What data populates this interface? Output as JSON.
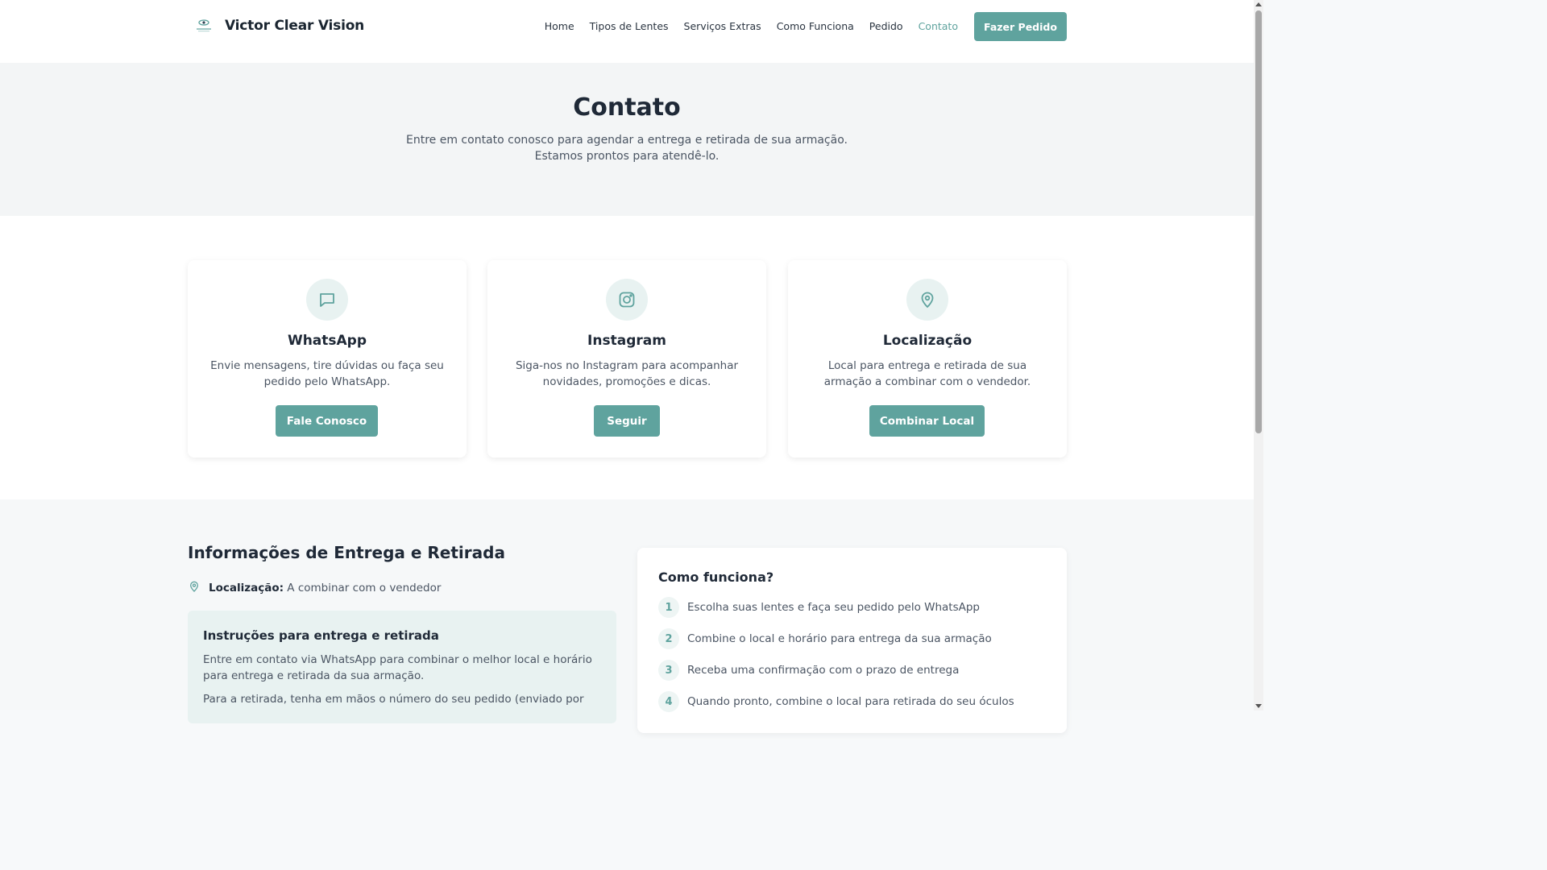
{
  "header": {
    "brand_name": "Victor Clear Vision",
    "nav": [
      "Home",
      "Tipos de Lentes",
      "Serviços Extras",
      "Como Funciona",
      "Pedido",
      "Contato"
    ],
    "active_nav": "Contato",
    "cta_label": "Fazer Pedido"
  },
  "hero": {
    "title": "Contato",
    "subtitle_line1": "Entre em contato conosco para agendar a entrega e retirada de sua armação.",
    "subtitle_line2": "Estamos prontos para atendê-lo."
  },
  "cards": [
    {
      "icon": "chat-bubble-icon",
      "title": "WhatsApp",
      "desc_line1": "Envie mensagens, tire dúvidas ou faça seu",
      "desc_line2": "pedido pelo WhatsApp.",
      "button": "Fale Conosco"
    },
    {
      "icon": "instagram-icon",
      "title": "Instagram",
      "desc_line1": "Siga-nos no Instagram para acompanhar",
      "desc_line2": "novidades, promoções e dicas.",
      "button": "Seguir"
    },
    {
      "icon": "map-pin-icon",
      "title": "Localização",
      "desc_line1": "Local para entrega e retirada de sua",
      "desc_line2": "armação a combinar com o vendedor.",
      "button": "Combinar Local"
    }
  ],
  "info": {
    "title": "Informações de Entrega e Retirada",
    "location_label": "Localização:",
    "location_value": "A combinar com o vendedor",
    "instructions_title": "Instruções para entrega e retirada",
    "instructions_p1": "Entre em contato via WhatsApp para combinar o melhor local e horário para entrega e retirada da sua armação.",
    "instructions_p2": "Para a retirada, tenha em mãos o número do seu pedido (enviado por"
  },
  "how": {
    "title": "Como funciona?",
    "steps": [
      {
        "num": "1",
        "text": "Escolha suas lentes e faça seu pedido pelo WhatsApp"
      },
      {
        "num": "2",
        "text": "Combine o local e horário para entrega da sua armação"
      },
      {
        "num": "3",
        "text": "Receba uma confirmação com o prazo de entrega"
      },
      {
        "num": "4",
        "text": "Quando pronto, combine o local para retirada do seu óculos"
      }
    ]
  },
  "colors": {
    "accent": "#5fa39e",
    "accent_light": "#e8f2f1",
    "text_dark": "#1f2937",
    "text_muted": "#4b5563"
  }
}
